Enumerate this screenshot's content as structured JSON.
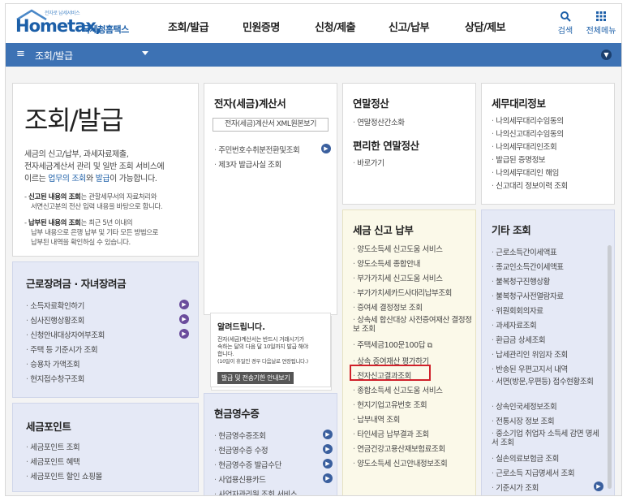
{
  "header": {
    "logo_sub": "전자로 납세서비스",
    "logo_main": "Hometax,",
    "logo_kr": "국세청홈택스",
    "nav": [
      "조회/발급",
      "민원증명",
      "신청/제출",
      "신고/납부",
      "상담/제보"
    ],
    "search_label": "검색",
    "allmenu_label": "전체메뉴"
  },
  "menubar": {
    "title": "조회/발급"
  },
  "intro": {
    "title": "조회/발급",
    "desc_line1": "세금의 신고/납부, 과세자료제출,",
    "desc_line2": "전자세금계산서 관리 및 일반 조회 서비스에",
    "desc_pre": "이르는 ",
    "desc_hl1": "업무의 조회",
    "desc_mid": "와 ",
    "desc_hl2": "발급",
    "desc_post": "이 가능합니다.",
    "note1_bold": "신고된 내용의 조회",
    "note1_rest": "는 관할세무서의 자료처리와",
    "note1_line2": "서면신고분의 전산 입력 내용을 바탕으로 합니다.",
    "note2_bold": "납부된 내용의 조회",
    "note2_rest": "는 최근 5년 이내의",
    "note2_line2": "납부 내용으로 은행 납부 및 기타 모든 방법으로",
    "note2_line3": "납부된 내역을 확인하실 수 있습니다."
  },
  "earned": {
    "title": "근로장려금 · 자녀장려금",
    "items": [
      "소득자료확인하기",
      "심사진행상황조회",
      "신청안내대상자여부조회",
      "주택 등 기준시가 조회",
      "승용차 가액조회",
      "현지접수창구조회"
    ]
  },
  "points": {
    "title": "세금포인트",
    "items": [
      "세금포인트 조회",
      "세금포인트 혜택",
      "세금포인트 할인 쇼핑몰"
    ]
  },
  "einvoice": {
    "title": "전자(세금)계산서",
    "button": "전자(세금)계산서 XML원본보기",
    "items": [
      "주민번호수취분전환및조회",
      "제3자 발급사실 조회"
    ]
  },
  "notice": {
    "title": "알려드립니다.",
    "text1": "전자(세금)계산서는 반드시 거래시기가",
    "text2": "속하는 달의 다음 달 10일까지 발급 해야",
    "text3": "합니다.",
    "text4": "(10일이 휴일인 경우 다음날로 연장됩니다.)",
    "button": "발급 및 전송기한 안내보기"
  },
  "cashreceipt": {
    "title": "현금영수증",
    "items": [
      "현금영수증조회",
      "현금영수증 수정",
      "현금영수증 발급수단",
      "사업용신용카드",
      "사업자관리원 조회 서비스"
    ]
  },
  "yearend": {
    "title": "연말정산",
    "items": [
      "연말정산간소화"
    ],
    "title2": "편리한 연말정산",
    "items2": [
      "바로가기"
    ]
  },
  "taxreport": {
    "title": "세금 신고 납부",
    "items": [
      "양도소득세 신고도움 서비스",
      "양도소득세 종합안내",
      "부가가치세 신고도움 서비스",
      "부가가치세카드사대리납부조회",
      "증여세 결정정보 조회",
      "상속세 합산대상 사전증여재산 결정정보 조회",
      "주택세금100문100답",
      "상속 증여재산 평가하기",
      "전자신고결과조회",
      "종합소득세 신고도움 서비스",
      "현지기업고유번호 조회",
      "납부내역 조회",
      "타인세금 납부결과 조회",
      "연금건강고용산재보험료조회",
      "양도소득세 신고안내정보조회"
    ]
  },
  "agent": {
    "title": "세무대리정보",
    "items": [
      "나의세무대리수임동의",
      "나의신고대리수임동의",
      "나의세무대리인조회",
      "발급된 증명정보",
      "나의세무대리인 해임",
      "신고대리 정보이력 조회"
    ]
  },
  "other": {
    "title": "기타 조회",
    "items": [
      "근로소득간이세액표",
      "종교인소득간이세액표",
      "불복청구진행상황",
      "불복청구사전열람자료",
      "위원회회의자료",
      "과세자료조회",
      "환급금 상세조회",
      "납세관리인 위임자 조회",
      "반송된 우편고지서 내역",
      "서면(방문,우편등) 접수현황조회",
      "상속인국세정보조회",
      "전통시장 정보 조회",
      "중소기업 취업자 소득세 감면 명세서 조회",
      "실손의료보험금 조회",
      "근로소득 지급명세서 조회",
      "기준시가 조회"
    ]
  },
  "colors": {
    "brand": "#1c5fa8",
    "menubar": "#3d72b4",
    "highlight": "#d0202a"
  }
}
